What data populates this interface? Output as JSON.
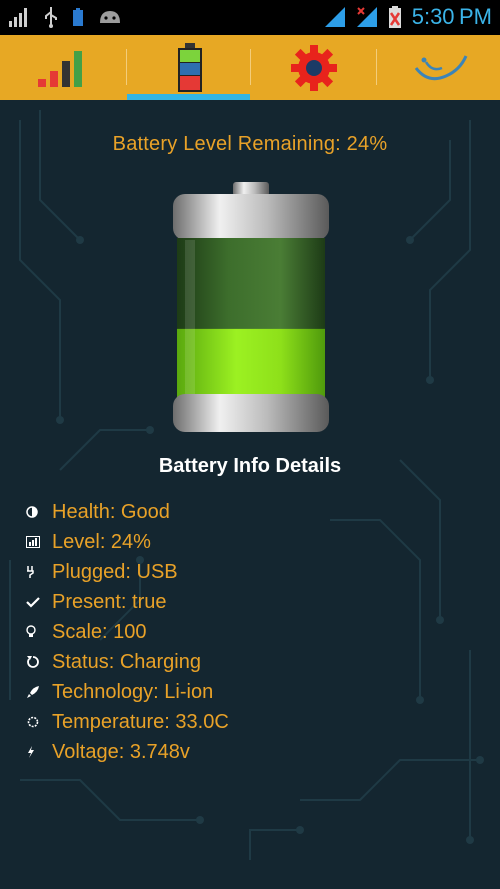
{
  "status_bar": {
    "time": "5:30",
    "time_suffix": "PM",
    "left_icons": [
      "signal-bars-icon",
      "usb-icon",
      "battery-small-icon",
      "android-icon"
    ],
    "right_icons": [
      "wifi-icon",
      "cell-signal-icon",
      "battery-charging-icon"
    ]
  },
  "tabs": [
    {
      "name": "signal",
      "icon": "signal-strength-icon"
    },
    {
      "name": "battery",
      "icon": "battery-tab-icon",
      "selected": true
    },
    {
      "name": "settings",
      "icon": "gear-icon"
    },
    {
      "name": "about",
      "icon": "wave-icon"
    }
  ],
  "colors": {
    "tab_bar": "#e7a824",
    "indicator": "#33b5e5",
    "text_orange": "#e9a228",
    "background": "#142630",
    "battery_fill": "#8ee01a"
  },
  "battery": {
    "remaining_label": "Battery Level Remaining: 24%",
    "fill_fraction": 0.24
  },
  "details": {
    "title": "Battery Info Details",
    "items": [
      {
        "icon": "half-circle-icon",
        "text": "Health: Good"
      },
      {
        "icon": "bar-chart-icon",
        "text": "Level: 24%"
      },
      {
        "icon": "plug-icon",
        "text": "Plugged: USB"
      },
      {
        "icon": "checkmark-icon",
        "text": "Present: true"
      },
      {
        "icon": "lightbulb-icon",
        "text": "Scale: 100"
      },
      {
        "icon": "refresh-icon",
        "text": "Status: Charging"
      },
      {
        "icon": "rocket-icon",
        "text": "Technology: Li-ion"
      },
      {
        "icon": "sun-icon",
        "text": "Temperature: 33.0C"
      },
      {
        "icon": "lightning-icon",
        "text": "Voltage: 3.748v"
      }
    ]
  }
}
